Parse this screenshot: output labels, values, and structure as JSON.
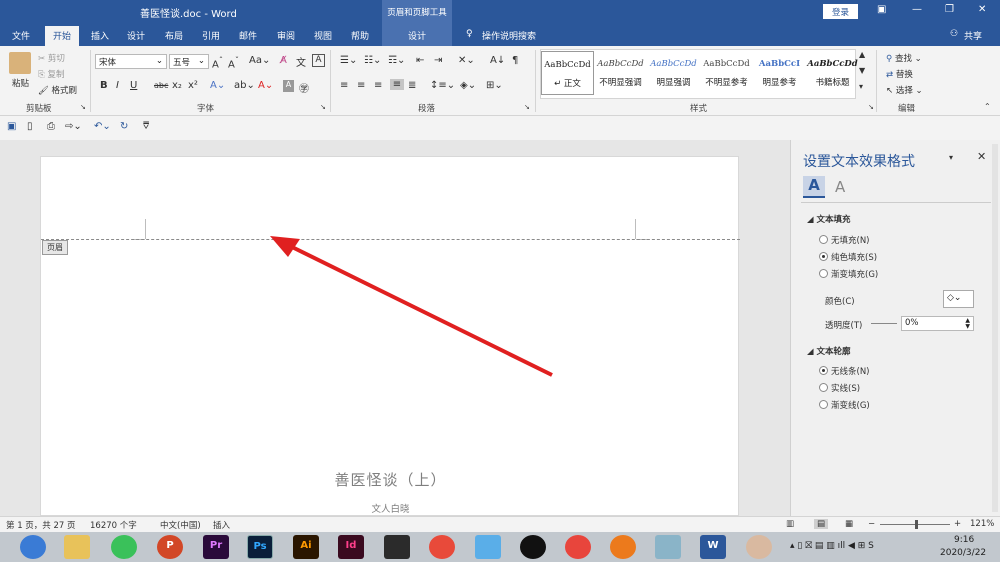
{
  "window": {
    "title": "善医怪谈.doc  -  Word",
    "context_header": "页眉和页脚工具",
    "login": "登录"
  },
  "tabs": [
    "文件",
    "开始",
    "插入",
    "设计",
    "布局",
    "引用",
    "邮件",
    "审阅",
    "视图",
    "帮助",
    "设计"
  ],
  "tell_me": "操作说明搜索",
  "share": "共享",
  "clipboard": {
    "paste": "粘贴",
    "cut": "剪切",
    "copy": "复制",
    "format_painter": "格式刷",
    "group": "剪贴板"
  },
  "font": {
    "name": "宋体",
    "size": "五号",
    "group": "字体"
  },
  "paragraph": {
    "group": "段落"
  },
  "styles": {
    "items": [
      {
        "sample": "AaBbCcDd",
        "name": "↵ 正文"
      },
      {
        "sample": "AaBbCcDd",
        "name": "不明显强调"
      },
      {
        "sample": "AaBbCcDd",
        "name": "明显强调"
      },
      {
        "sample": "AaBbCcDd",
        "name": "不明显参考"
      },
      {
        "sample": "AaBbCcI",
        "name": "明显参考"
      },
      {
        "sample": "AaBbCcDd",
        "name": "书籍标题"
      }
    ],
    "group": "样式"
  },
  "editing": {
    "find": "查找",
    "replace": "替换",
    "select": "选择",
    "group": "编辑"
  },
  "document": {
    "header_tag": "页眉",
    "title": "善医怪谈（上）",
    "author": "文人白晓"
  },
  "pane": {
    "title": "设置文本效果格式",
    "fill_section": "文本填充",
    "fill_options": [
      "无填充(N)",
      "纯色填充(S)",
      "渐变填充(G)"
    ],
    "color_label": "颜色(C)",
    "transparency_label": "透明度(T)",
    "transparency_value": "0%",
    "outline_section": "文本轮廓",
    "outline_options": [
      "无线条(N)",
      "实线(S)",
      "渐变线(G)"
    ]
  },
  "status": {
    "page": "第 1 页，共 27 页",
    "words": "16270 个字",
    "lang": "中文(中国)",
    "mode": "插入",
    "zoom": "121%"
  },
  "taskbar": {
    "time": "9:16",
    "date": "2020/3/22",
    "apps": [
      "Pr",
      "Ps",
      "Ai",
      "Id"
    ]
  },
  "colors": {
    "word_blue": "#2b579a",
    "arrow": "#e02020"
  }
}
